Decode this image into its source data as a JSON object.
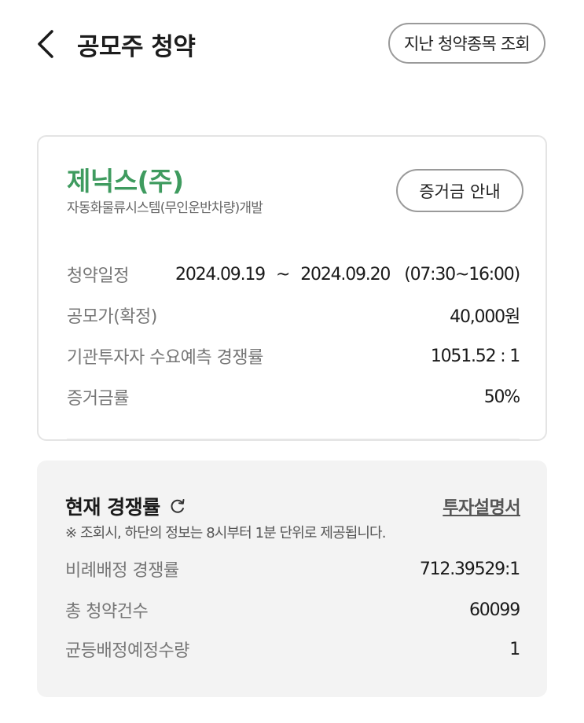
{
  "header": {
    "title": "공모주 청약",
    "history_button": "지난 청약종목 조회"
  },
  "company": {
    "name": "제닉스(주)",
    "description": "자동화물류시스템(무인운반차량)개발",
    "margin_guide_button": "증거금 안내",
    "color": "#3f9b5f"
  },
  "info": {
    "schedule": {
      "label": "청약일정",
      "start": "2024.09.19",
      "separator": "~",
      "end": "2024.09.20",
      "hours": "(07:30~16:00)"
    },
    "offer_price": {
      "label": "공모가(확정)",
      "value": "40,000원"
    },
    "institutional_rate": {
      "label": "기관투자자 수요예측 경쟁률",
      "value": "1051.52 : 1"
    },
    "margin_rate": {
      "label": "증거금률",
      "value": "50%"
    }
  },
  "competition": {
    "title": "현재 경쟁률",
    "refresh_icon": "refresh-icon",
    "prospectus_link": "투자설명서",
    "notice": "※ 조회시, 하단의 정보는 8시부터 1분 단위로 제공됩니다.",
    "rows": [
      {
        "label": "비례배정 경쟁률",
        "value": "712.39529:1"
      },
      {
        "label": "총 청약건수",
        "value": "60099"
      },
      {
        "label": "균등배정예정수량",
        "value": "1"
      }
    ]
  }
}
